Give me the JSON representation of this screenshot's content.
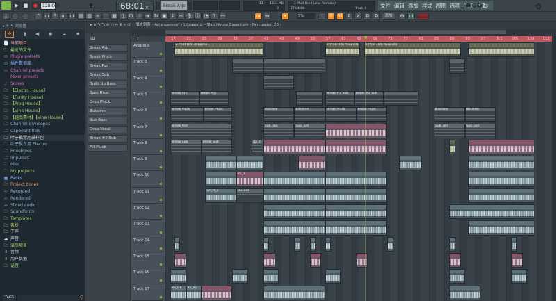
{
  "transport": {
    "tempo": "128.000",
    "time": "68:01",
    "time_sub": "00",
    "pattern": "Break Arp",
    "memory": "1333 MB",
    "cpu": "11",
    "polyphony": "0"
  },
  "hint": {
    "title": "2 Phút Hơn(Salas Remake)",
    "time": "27 04 04",
    "track": "Track 4"
  },
  "menu": [
    "文件",
    "编辑",
    "添加",
    "样式",
    "视图",
    "选项",
    "工具",
    "帮助"
  ],
  "toolbar": {
    "snap": "5%",
    "btn_drag": "拉",
    "btn_alt": "Alt",
    "btn_b": "B",
    "btn_add": "添加"
  },
  "browser": {
    "title": "浏览器",
    "tags_label": "TAGS",
    "items": [
      {
        "label": "当前项目",
        "color": "#e9a0a0",
        "icon": "📄"
      },
      {
        "label": "最近的文件",
        "color": "#9fd36a",
        "icon": "🗀"
      },
      {
        "label": "Plugin presets",
        "color": "#d06ac0",
        "icon": "⏻"
      },
      {
        "label": "插件数据库",
        "color": "#8fb3ff",
        "icon": "⏻"
      },
      {
        "label": "Channel presets",
        "color": "#d06ac0",
        "icon": "▭"
      },
      {
        "label": "Mixer presets",
        "color": "#d06ac0",
        "icon": "⫶"
      },
      {
        "label": "Scores",
        "color": "#d06ac0",
        "icon": "♪"
      },
      {
        "label": "【Electro House】",
        "color": "#9fd36a",
        "icon": "🗀"
      },
      {
        "label": "【FunKy House】",
        "color": "#9fd36a",
        "icon": "🗀"
      },
      {
        "label": "【Prog House】",
        "color": "#9fd36a",
        "icon": "🗀"
      },
      {
        "label": "【Vina House】",
        "color": "#9fd36a",
        "icon": "🗀"
      },
      {
        "label": "【越南素材】【Vina House】",
        "color": "#9fd36a",
        "icon": "🗀"
      },
      {
        "label": "Channel envelopes",
        "color": "#8ab2c8",
        "icon": "🗀"
      },
      {
        "label": "Clipboard files",
        "color": "#8ab2c8",
        "icon": "🗀"
      },
      {
        "label": "叶子枫常用采样包",
        "color": "#e6ecef",
        "icon": "🗀"
      },
      {
        "label": "叶子枫专用 Electro",
        "color": "#8ab2c8",
        "icon": "🗀"
      },
      {
        "label": "Envelopes",
        "color": "#8ab2c8",
        "icon": "🗀"
      },
      {
        "label": "Impulses",
        "color": "#8ab2c8",
        "icon": "🗀"
      },
      {
        "label": "Misc",
        "color": "#8ab2c8",
        "icon": "🗀"
      },
      {
        "label": "My projects",
        "color": "#9fd36a",
        "icon": "🗀"
      },
      {
        "label": "Packs",
        "color": "#8fb3ff",
        "icon": "▦"
      },
      {
        "label": "Project bones",
        "color": "#e69a6a",
        "icon": "🗀"
      },
      {
        "label": "Recorded",
        "color": "#8ab2c8",
        "icon": "⊹"
      },
      {
        "label": "Rendered",
        "color": "#8ab2c8",
        "icon": "⊹"
      },
      {
        "label": "Sliced audio",
        "color": "#8ab2c8",
        "icon": "⊹"
      },
      {
        "label": "Soundfonts",
        "color": "#8ab2c8",
        "icon": "🗀"
      },
      {
        "label": "Templates",
        "color": "#9fd36a",
        "icon": "🗀"
      },
      {
        "label": "备份",
        "color": "#c8d36a",
        "icon": "🗀"
      },
      {
        "label": "干声",
        "color": "#cdd6da",
        "icon": "🗀"
      },
      {
        "label": "声音",
        "color": "#cdd6da",
        "icon": "☁"
      },
      {
        "label": "演示项目",
        "color": "#9fd36a",
        "icon": "🗀"
      },
      {
        "label": "音频",
        "color": "#cdd6da",
        "icon": "⬇"
      },
      {
        "label": "用户数据",
        "color": "#cdd6da",
        "icon": "⬇"
      },
      {
        "label": "语音",
        "color": "#9fd36a",
        "icon": "🗀"
      }
    ]
  },
  "channels": [
    "Break Arp",
    "Break Pluck",
    "Break Pad",
    "Break Sub",
    "Build Up Bass",
    "Bass Riser",
    "Drop Pluck",
    "Bassline",
    "Sub Bass",
    "Drop Vocal",
    "Break #2 Sub",
    "Fill Pluck"
  ],
  "breadcrumb": "播放列表 - Arrangement › Ultrasonic - Slap House Essentials - Percussion 28 ›",
  "ruler": [
    17,
    21,
    25,
    29,
    33,
    37,
    41,
    45,
    49,
    53,
    57,
    61,
    65,
    69,
    73,
    77,
    81,
    85,
    89,
    93,
    97,
    101,
    105,
    109,
    113
  ],
  "tracks": [
    "Acapella",
    "Track 3",
    "Track 4",
    "Track 5",
    "Track 6",
    "Track 7",
    "Track 8",
    "Track 9",
    "Track 10",
    "Track 11",
    "Track 12",
    "Track 13",
    "Track 14",
    "Track 15",
    "Track 16",
    "Track 17"
  ],
  "colors": {
    "accent": "#f0902a",
    "ruler": "#c0595d",
    "olive": "#676b55",
    "pattern": "#5d656d",
    "pink": "#8a5468",
    "blue": "#5b7078"
  },
  "clips": [
    {
      "t": 0,
      "s": 18,
      "l": 23,
      "n": "2 Phút Hơn Acapella",
      "k": "olive"
    },
    {
      "t": 0,
      "s": 57,
      "l": 9,
      "n": "2 Phút Hơn Acapella",
      "k": "olive"
    },
    {
      "t": 0,
      "s": 67,
      "l": 25,
      "n": "2 Phút Hơn Acapella",
      "k": "olive"
    },
    {
      "t": 0,
      "s": 94,
      "l": 17,
      "n": "",
      "k": "olive"
    },
    {
      "t": 1,
      "s": 33,
      "l": 8,
      "n": "",
      "k": "pat"
    },
    {
      "t": 1,
      "s": 41,
      "l": 16,
      "n": "",
      "k": "pat"
    },
    {
      "t": 1,
      "s": 89,
      "l": 4,
      "n": "",
      "k": "pat"
    },
    {
      "t": 2,
      "s": 41,
      "l": 8,
      "n": "",
      "k": "pat"
    },
    {
      "t": 3,
      "s": 17,
      "l": 7.5,
      "n": "Break Arp",
      "k": "pat"
    },
    {
      "t": 3,
      "s": 24.5,
      "l": 7.5,
      "n": "Break Arp",
      "k": "pat"
    },
    {
      "t": 3,
      "s": 49.5,
      "l": 7,
      "n": "",
      "k": "pat"
    },
    {
      "t": 3,
      "s": 57,
      "l": 7.5,
      "n": "Break #2 Sub",
      "k": "pat"
    },
    {
      "t": 3,
      "s": 64.5,
      "l": 7.5,
      "n": "Break #2 Sub",
      "k": "pat"
    },
    {
      "t": 3,
      "s": 72,
      "l": 9,
      "n": "",
      "k": "pat"
    },
    {
      "t": 4,
      "s": 17,
      "l": 8.5,
      "n": "Break Pluck",
      "k": "pat"
    },
    {
      "t": 4,
      "s": 25.5,
      "l": 7.5,
      "n": "Break Pluck",
      "k": "pat"
    },
    {
      "t": 4,
      "s": 41,
      "l": 8,
      "n": "Bassline",
      "k": "pat"
    },
    {
      "t": 4,
      "s": 49,
      "l": 8,
      "n": "Bassline",
      "k": "pat"
    },
    {
      "t": 4,
      "s": 57,
      "l": 8,
      "n": "Break Pluck",
      "k": "pat"
    },
    {
      "t": 4,
      "s": 65,
      "l": 8,
      "n": "Break Pluck",
      "k": "pat"
    },
    {
      "t": 4,
      "s": 85,
      "l": 8,
      "n": "Bassline",
      "k": "pat"
    },
    {
      "t": 4,
      "s": 93,
      "l": 8,
      "n": "Bassline",
      "k": "pat"
    },
    {
      "t": 5,
      "s": 17,
      "l": 16,
      "n": "Break Pad",
      "k": "pat"
    },
    {
      "t": 5,
      "s": 41,
      "l": 8,
      "n": "Sub..ass",
      "k": "pat"
    },
    {
      "t": 5,
      "s": 49,
      "l": 8,
      "n": "Sub..ass",
      "k": "pat"
    },
    {
      "t": 5,
      "s": 57,
      "l": 16,
      "n": "",
      "k": "pink"
    },
    {
      "t": 5,
      "s": 85,
      "l": 8,
      "n": "Sub..ass",
      "k": "pat"
    },
    {
      "t": 5,
      "s": 93,
      "l": 8,
      "n": "Sub..ass",
      "k": "pat"
    },
    {
      "t": 6,
      "s": 17,
      "l": 8,
      "n": "Break Sub",
      "k": "pat"
    },
    {
      "t": 6,
      "s": 25,
      "l": 8,
      "n": "Break Sub",
      "k": "pat"
    },
    {
      "t": 6,
      "s": 38,
      "l": 3,
      "n": "Ba..r",
      "k": "pat"
    },
    {
      "t": 6,
      "s": 41,
      "l": 16,
      "n": "",
      "k": "pink"
    },
    {
      "t": 6,
      "s": 57,
      "l": 16,
      "n": "",
      "k": "pink"
    },
    {
      "t": 6,
      "s": 89,
      "l": 1.5,
      "n": "",
      "k": "olive"
    },
    {
      "t": 6,
      "s": 94,
      "l": 17,
      "n": "",
      "k": "pink"
    },
    {
      "t": 7,
      "s": 26,
      "l": 8,
      "n": "",
      "k": "blue"
    },
    {
      "t": 7,
      "s": 34,
      "l": 7,
      "n": "",
      "k": "blue"
    },
    {
      "t": 7,
      "s": 50,
      "l": 7,
      "n": "",
      "k": "pink"
    },
    {
      "t": 7,
      "s": 76,
      "l": 6,
      "n": "",
      "k": "blue"
    },
    {
      "t": 7,
      "s": 94,
      "l": 17,
      "n": "",
      "k": "blue"
    },
    {
      "t": 8,
      "s": 26,
      "l": 8,
      "n": "",
      "k": "blue"
    },
    {
      "t": 8,
      "s": 34,
      "l": 7,
      "n": "85_1",
      "k": "pink"
    },
    {
      "t": 8,
      "s": 41,
      "l": 16,
      "n": "",
      "k": "blue"
    },
    {
      "t": 8,
      "s": 57,
      "l": 16,
      "n": "",
      "k": "blue"
    },
    {
      "t": 8,
      "s": 94,
      "l": 17,
      "n": "",
      "k": "blue"
    },
    {
      "t": 9,
      "s": 26,
      "l": 8,
      "n": "Sh_M_1",
      "k": "blue"
    },
    {
      "t": 9,
      "s": 34,
      "l": 7,
      "n": "Bu..ass",
      "k": "pat"
    },
    {
      "t": 9,
      "s": 41,
      "l": 16,
      "n": "",
      "k": "blue"
    },
    {
      "t": 9,
      "s": 57,
      "l": 16,
      "n": "",
      "k": "blue"
    },
    {
      "t": 9,
      "s": 94,
      "l": 17,
      "n": "",
      "k": "blue"
    },
    {
      "t": 10,
      "s": 41,
      "l": 16,
      "n": "",
      "k": "blue"
    },
    {
      "t": 10,
      "s": 57,
      "l": 16,
      "n": "",
      "k": "blue"
    },
    {
      "t": 10,
      "s": 89,
      "l": 22,
      "n": "",
      "k": "blue"
    },
    {
      "t": 11,
      "s": 41,
      "l": 16,
      "n": "",
      "k": "blue"
    },
    {
      "t": 11,
      "s": 57,
      "l": 16,
      "n": "",
      "k": "blue"
    },
    {
      "t": 11,
      "s": 94,
      "l": 17,
      "n": "",
      "k": "blue"
    },
    {
      "t": 12,
      "s": 18,
      "l": 1.5,
      "n": "",
      "k": "blue"
    },
    {
      "t": 12,
      "s": 41,
      "l": 1.5,
      "n": "",
      "k": "blue"
    },
    {
      "t": 12,
      "s": 49,
      "l": 1.5,
      "n": "",
      "k": "blue"
    },
    {
      "t": 12,
      "s": 53,
      "l": 1.5,
      "n": "",
      "k": "blue"
    },
    {
      "t": 12,
      "s": 57,
      "l": 1.5,
      "n": "",
      "k": "blue"
    },
    {
      "t": 12,
      "s": 73,
      "l": 1.5,
      "n": "",
      "k": "blue"
    },
    {
      "t": 12,
      "s": 89,
      "l": 1.5,
      "n": "",
      "k": "blue"
    },
    {
      "t": 12,
      "s": 105,
      "l": 1.5,
      "n": "",
      "k": "blue"
    },
    {
      "t": 13,
      "s": 18,
      "l": 3,
      "n": "",
      "k": "pink"
    },
    {
      "t": 13,
      "s": 41,
      "l": 3,
      "n": "",
      "k": "pink"
    },
    {
      "t": 13,
      "s": 53,
      "l": 3,
      "n": "",
      "k": "pink"
    },
    {
      "t": 13,
      "s": 65,
      "l": 3,
      "n": "",
      "k": "pink"
    },
    {
      "t": 13,
      "s": 89,
      "l": 3,
      "n": "",
      "k": "pink"
    },
    {
      "t": 13,
      "s": 105,
      "l": 3,
      "n": "",
      "k": "pink"
    },
    {
      "t": 14,
      "s": 17,
      "l": 4,
      "n": "",
      "k": "blue"
    },
    {
      "t": 14,
      "s": 33,
      "l": 4,
      "n": "",
      "k": "blue"
    },
    {
      "t": 14,
      "s": 41,
      "l": 4,
      "n": "",
      "k": "blue"
    },
    {
      "t": 14,
      "s": 57,
      "l": 4,
      "n": "",
      "k": "blue"
    },
    {
      "t": 14,
      "s": 89,
      "l": 4,
      "n": "",
      "k": "blue"
    },
    {
      "t": 14,
      "s": 105,
      "l": 4,
      "n": "",
      "k": "blue"
    },
    {
      "t": 15,
      "s": 17,
      "l": 4,
      "n": "85_01",
      "k": "blue"
    },
    {
      "t": 15,
      "s": 21,
      "l": 4,
      "n": "85_01",
      "k": "blue"
    },
    {
      "t": 15,
      "s": 25,
      "l": 8,
      "n": "",
      "k": "pink"
    },
    {
      "t": 15,
      "s": 41,
      "l": 16,
      "n": "",
      "k": "blue"
    },
    {
      "t": 15,
      "s": 89,
      "l": 8,
      "n": "",
      "k": "blue"
    }
  ]
}
